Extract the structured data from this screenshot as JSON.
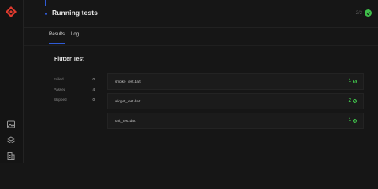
{
  "header": {
    "title": "Running tests",
    "status_count": "2/2",
    "accent_color": "#2f5bd6",
    "success_color": "#3fbf4a"
  },
  "tabs": [
    {
      "label": "Results",
      "active": true
    },
    {
      "label": "Log",
      "active": false
    }
  ],
  "section": {
    "title": "Flutter Test"
  },
  "summary": [
    {
      "label": "Failed",
      "value": "0"
    },
    {
      "label": "Passed",
      "value": "4"
    },
    {
      "label": "Skipped",
      "value": "0"
    }
  ],
  "files": [
    {
      "name": "smoke_test.dart",
      "count": "1"
    },
    {
      "name": "widget_test.dart",
      "count": "2"
    },
    {
      "name": "unit_test.dart",
      "count": "1"
    }
  ],
  "rail": {
    "icons": [
      "logo-icon",
      "image-icon",
      "layers-icon",
      "building-icon"
    ]
  }
}
